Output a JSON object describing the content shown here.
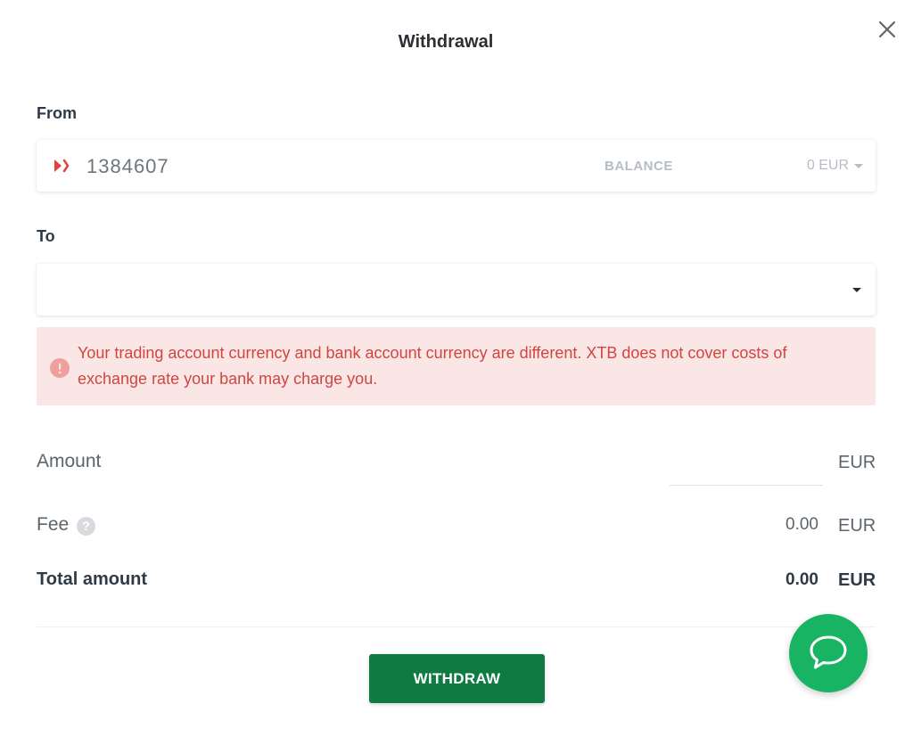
{
  "dialog": {
    "title": "Withdrawal"
  },
  "from": {
    "label": "From",
    "account_number": "1384607",
    "balance_label": "BALANCE",
    "balance_value": "0 EUR",
    "account_icon": "xtb-logo-icon"
  },
  "to": {
    "label": "To",
    "selected": ""
  },
  "alert": {
    "message": "Your trading account currency and bank account currency are different. XTB does not cover costs of exchange rate your bank may charge you.",
    "icon": "info-icon"
  },
  "amount": {
    "label": "Amount",
    "value": "",
    "currency": "EUR"
  },
  "fee": {
    "label": "Fee",
    "value": "0.00",
    "currency": "EUR",
    "help_glyph": "?"
  },
  "total": {
    "label": "Total amount",
    "value": "0.00",
    "currency": "EUR"
  },
  "actions": {
    "withdraw_label": "WITHDRAW"
  },
  "colors": {
    "primary_green": "#0f7a42",
    "chat_green": "#19b463",
    "alert_bg": "#fbe6e6",
    "alert_text": "#d0453f"
  }
}
